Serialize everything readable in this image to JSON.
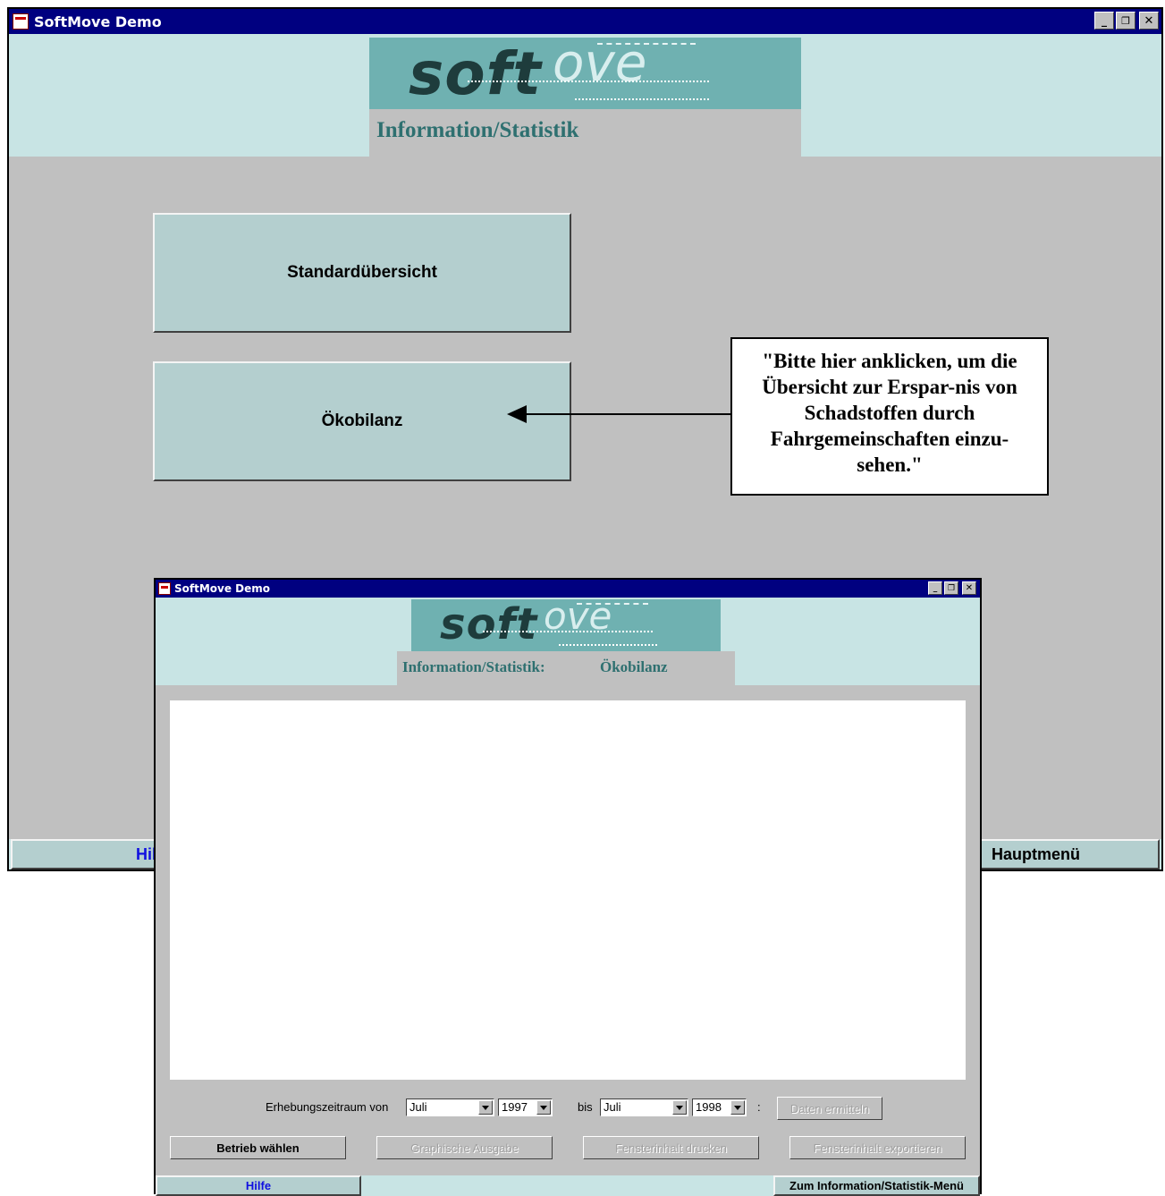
{
  "main_window": {
    "title": "SoftMove Demo",
    "logo": {
      "soft": "soft",
      "ove": "ove"
    },
    "section_title": "Information/Statistik",
    "buttons": {
      "standard": "Standardübersicht",
      "oeko": "Ökobilanz"
    },
    "callout": "\"Bitte hier anklicken, um die Übersicht zur Erspar-nis von Schadstoffen durch Fahrgemeinschaften einzu-sehen.\"",
    "bottom": {
      "help_label": "Hil",
      "main_menu_label": "Hauptmenü"
    }
  },
  "sub_window": {
    "title": "SoftMove Demo",
    "logo": {
      "soft": "soft",
      "ove": "ove"
    },
    "section_title": "Information/Statistik:",
    "section_subtitle": "Ökobilanz",
    "period": {
      "label_from": "Erhebungszeitraum von",
      "from_month": "Juli",
      "from_year": "1997",
      "label_to": "bis",
      "to_month": "Juli",
      "to_year": "1998",
      "colon": ":",
      "fetch_button": "Daten ermitteln"
    },
    "actions": {
      "select_company": "Betrieb wählen",
      "graphic_output": "Graphische Ausgabe",
      "print": "Fensterinhalt drucken",
      "export": "Fensterinhalt exportieren"
    },
    "bottom": {
      "help": "Hilfe",
      "back": "Zum Information/Statistik-Menü"
    }
  },
  "colors": {
    "titlebar": "#000080",
    "header": "#c8e4e4",
    "logo_bg": "#6fb1b1",
    "accent_text": "#2e7070",
    "button_face": "#b4cfcf",
    "link_blue": "#1010e0"
  }
}
